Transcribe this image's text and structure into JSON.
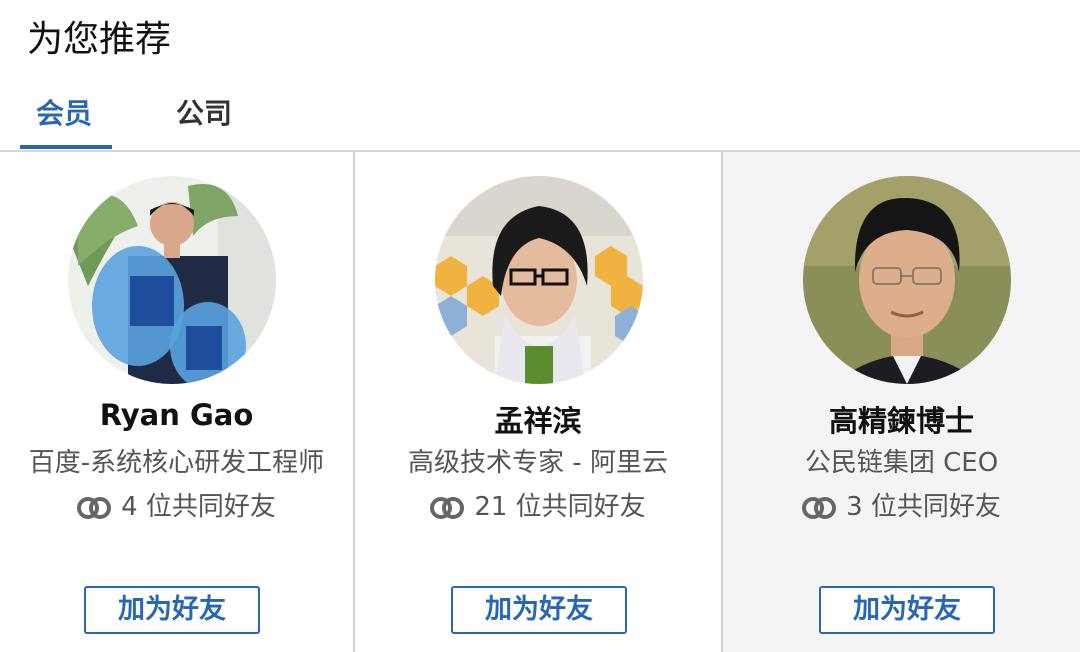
{
  "section_title": "为您推荐",
  "tabs": [
    {
      "label": "会员",
      "active": true
    },
    {
      "label": "公司",
      "active": false
    }
  ],
  "accent_color": "#2867b2",
  "cards": [
    {
      "name": "Ryan Gao",
      "headline": "百度-系统核心研发工程师",
      "mutual": "4 位共同好友",
      "button": "加为好友",
      "avatar_icon": "profile-photo"
    },
    {
      "name": "孟祥滨",
      "headline": "高级技术专家 - 阿里云",
      "mutual": "21 位共同好友",
      "button": "加为好友",
      "avatar_icon": "profile-photo"
    },
    {
      "name": "高精鍊博士",
      "headline": "公民链集团 CEO",
      "mutual": "3 位共同好友",
      "button": "加为好友",
      "avatar_icon": "profile-photo"
    }
  ]
}
